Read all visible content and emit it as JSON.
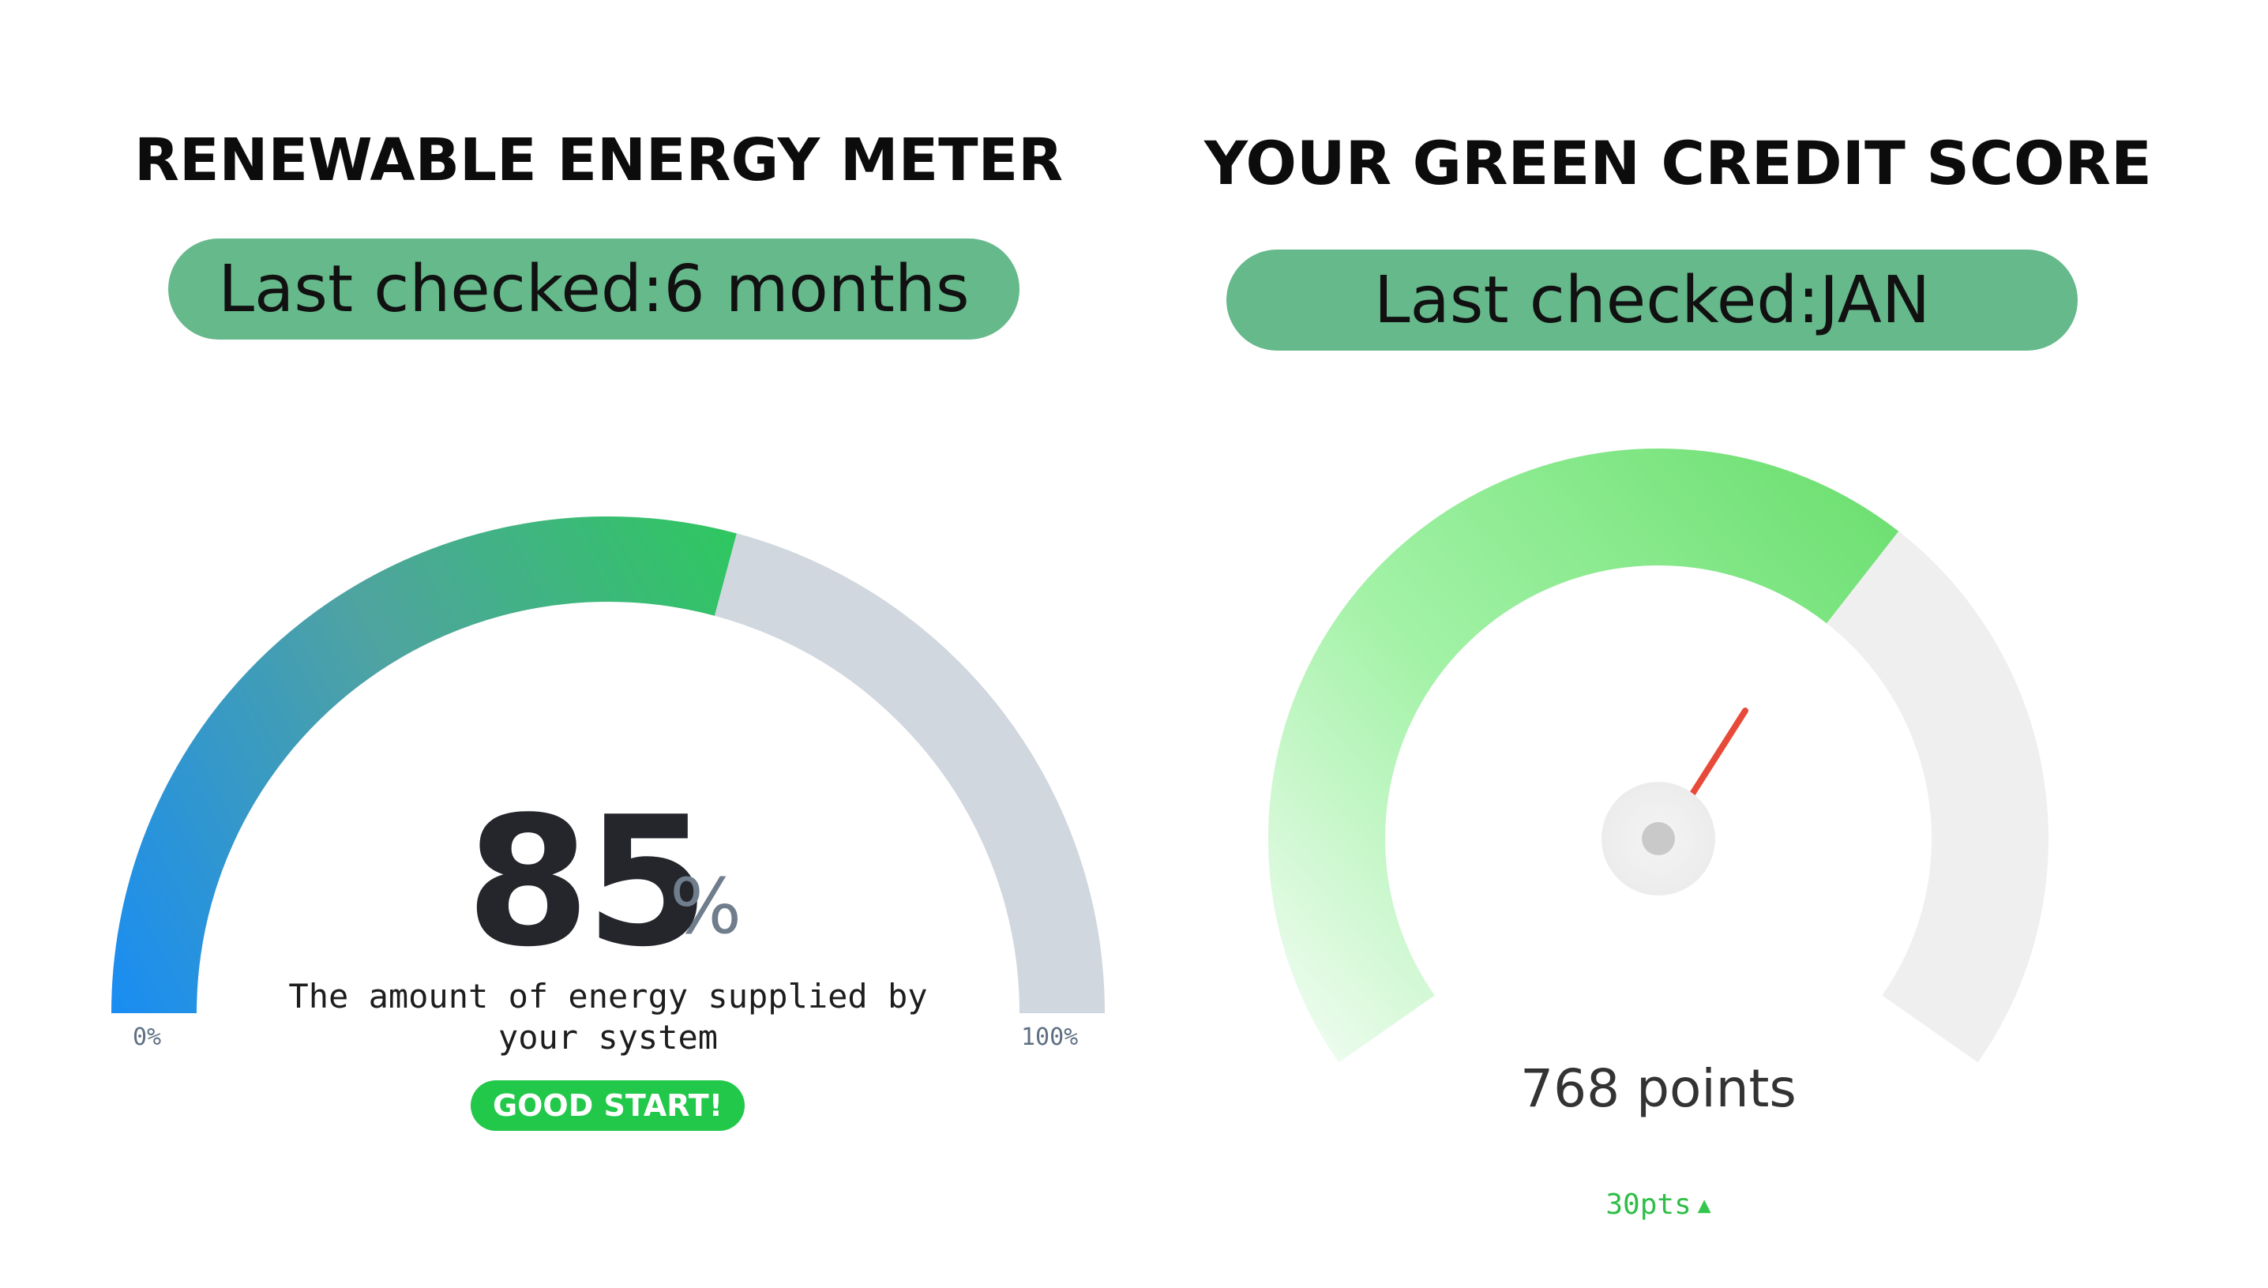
{
  "renewable_meter": {
    "title": "RENEWABLE ENERGY METER",
    "last_checked": "Last checked:6 months",
    "value": "85",
    "unit": "%",
    "value_fraction": 0.85,
    "description": "The amount of energy supplied by your system",
    "min_label": "0%",
    "max_label": "100%",
    "status": "GOOD START!"
  },
  "green_credit": {
    "title": "YOUR GREEN CREDIT SCORE",
    "last_checked": "Last checked:JAN",
    "score": "768 points",
    "delta": "30pts",
    "delta_icon": "triangle-up-icon"
  },
  "colors": {
    "pill": "#66b98b",
    "meter_blue": "#1a8df2",
    "meter_green": "#24d34a",
    "meter_track": "#d0d7de",
    "credit_green_light": "#e8fbe9",
    "credit_green": "#7ae57d",
    "credit_track": "#efefef",
    "needle": "#e84a3a",
    "badge": "#22c84a"
  }
}
